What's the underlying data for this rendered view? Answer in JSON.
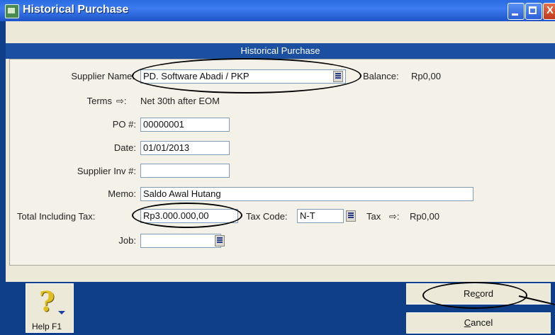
{
  "window": {
    "title": "Historical Purchase",
    "panel_header": "Historical Purchase",
    "icon": "app-icon",
    "controls": [
      "minimize-icon",
      "maximize-icon",
      "close-icon"
    ]
  },
  "form": {
    "supplier_name_label": "Supplier Name:",
    "supplier_name_value": "PD. Software Abadi / PKP",
    "balance_label": "Balance:",
    "balance_value": "Rp0,00",
    "terms_label": "Terms",
    "terms_arrow": "⇨:",
    "terms_value": "Net 30th after EOM",
    "po_label": "PO #:",
    "po_value": "00000001",
    "date_label": "Date:",
    "date_value": "01/01/2013",
    "supplier_inv_label": "Supplier Inv #:",
    "supplier_inv_value": "",
    "memo_label": "Memo:",
    "memo_value": "Saldo Awal Hutang",
    "total_label": "Total Including Tax:",
    "total_value": "Rp3.000.000,00",
    "tax_code_label": "Tax Code:",
    "tax_code_value": "N-T",
    "tax_label": "Tax",
    "tax_arrow": "⇨:",
    "tax_value": "Rp0,00",
    "job_label": "Job:",
    "job_value": ""
  },
  "footer": {
    "help_label": "Help F1",
    "help_icon": "question-icon",
    "record_pre": "Re",
    "record_ul": "c",
    "record_post": "ord",
    "cancel_ul": "C",
    "cancel_post": "ancel"
  }
}
